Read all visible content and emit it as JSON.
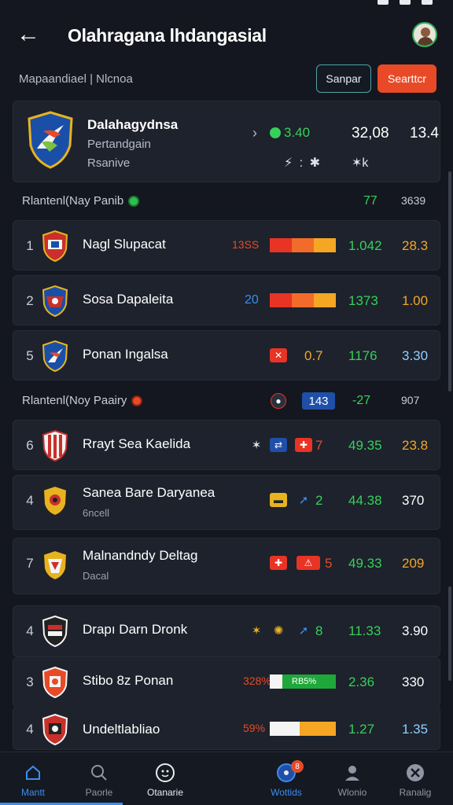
{
  "header": {
    "title": "Olahragana lhdangasial"
  },
  "subheader": {
    "breadcrumb": "Mapaandiael | Nlcnoa",
    "btn_outline": "Sanpar",
    "btn_primary": "Searttcr"
  },
  "featured": {
    "title": "Dalahagydnsa",
    "sub1": "Pertandgain",
    "sub2": "Rsanive",
    "chev": "›",
    "stat1": "3.40",
    "stat2": "32,08",
    "stat3": "13.4",
    "sym1": "⚡ : ✱",
    "sym2": "✶k"
  },
  "section1": {
    "label": "Rlantenl(Nay Panib",
    "v1": "77",
    "v2": "3639"
  },
  "section2": {
    "label": "Rlantenl(Noy Paairy",
    "badge": "143",
    "v1": "-27",
    "v2": "907"
  },
  "rows_top": [
    {
      "rank": "1",
      "name": "Nagl Slupacat",
      "marker": "13SS",
      "v1": "1.042",
      "v2": "28.3",
      "bar_colors": [
        "#e83325",
        "#f26b2a",
        "#f5a623"
      ],
      "bar_level": 1.0
    },
    {
      "rank": "2",
      "name": "Sosa Dapaleita",
      "marker": "20",
      "v1": "1373",
      "v2": "1.00",
      "bar_colors": [
        "#e83325",
        "#f26b2a",
        "#f5a623"
      ],
      "bar_level": 1.0
    },
    {
      "rank": "5",
      "name": "Ponan Ingalsa",
      "mini_val": "0.7",
      "v1": "1176",
      "v2": "3.30"
    }
  ],
  "rows_bottom": [
    {
      "rank": "6",
      "name": "Rrayt Sea Kaelida",
      "mini_val": "7",
      "v1": "49.35",
      "v2": "23.8"
    },
    {
      "rank": "4",
      "name": "Sanea Bare Daryanea",
      "sub": "6ncell",
      "mini_val": "2",
      "v1": "44.38",
      "v2": "370"
    },
    {
      "rank": "7",
      "name": "Malnandndy Deltag",
      "sub": "Dacal",
      "mini_val": "5",
      "v1": "49.33",
      "v2": "209"
    },
    {
      "rank": "4",
      "name": "Drapı Darn Dronk",
      "mini_val": "8",
      "v1": "11.33",
      "v2": "3.90"
    },
    {
      "rank": "3",
      "name": "Stibo 8z Ponan",
      "marker": "328%",
      "bar_text": "RB5%",
      "v1": "2.36",
      "v2": "330",
      "bar_level": 1.0
    },
    {
      "rank": "4",
      "name": "Undeltlabliao",
      "marker": "59%",
      "v1": "1.27",
      "v2": "1.35",
      "bar_level": 1.0
    }
  ],
  "nav": [
    {
      "label": "Mantt",
      "icon": "home-icon"
    },
    {
      "label": "Paorle",
      "icon": "search-icon"
    },
    {
      "label": "Otanarie",
      "icon": "scoreboard-icon"
    },
    {
      "label": "Wottids",
      "icon": "compass-icon",
      "badge": "8"
    },
    {
      "label": "Wlonio",
      "icon": "user-icon"
    },
    {
      "label": "Ranalig",
      "icon": "settings-icon"
    }
  ],
  "colors": {
    "accent_orange": "#e84a27",
    "green": "#37d05a",
    "amber": "#f5a623",
    "blue": "#3b8df0",
    "bg": "#14171f",
    "card": "#1d222c"
  }
}
